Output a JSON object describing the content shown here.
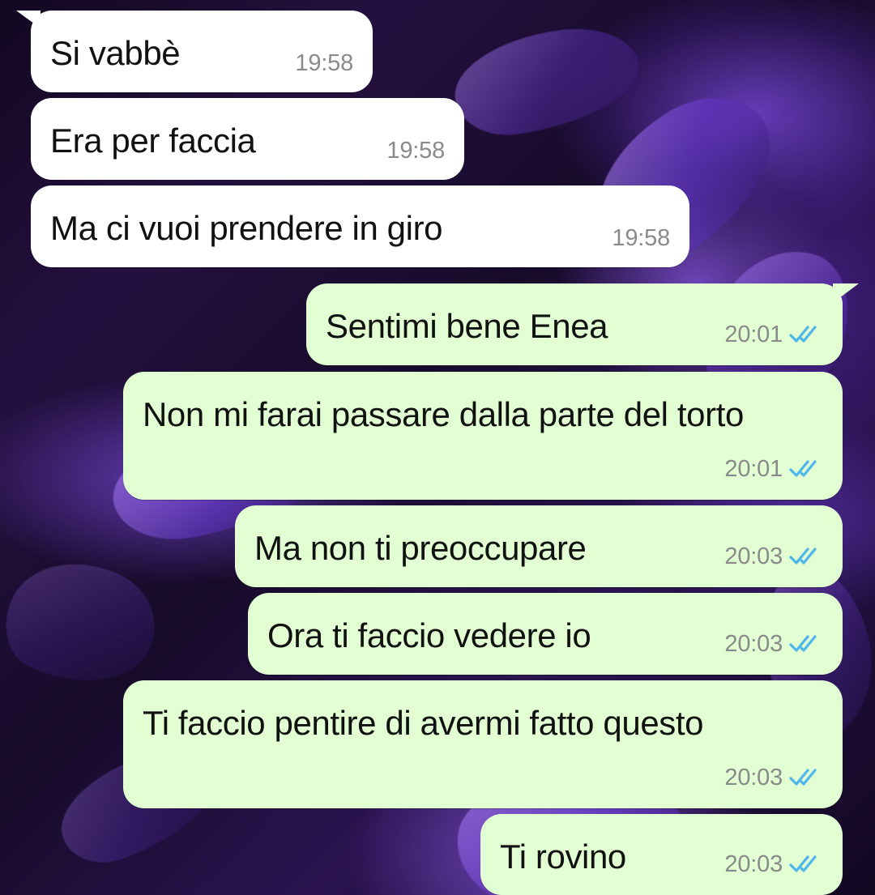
{
  "conversation": {
    "messages": [
      {
        "text": "Si vabbè",
        "time": "19:58"
      },
      {
        "text": "Era per faccia",
        "time": "19:58"
      },
      {
        "text": "Ma ci vuoi prendere in giro",
        "time": "19:58"
      },
      {
        "text": "Sentimi bene Enea",
        "time": "20:01"
      },
      {
        "text": "Non mi farai passare dalla parte del torto",
        "time": "20:01"
      },
      {
        "text": "Ma non ti preoccupare",
        "time": "20:03"
      },
      {
        "text": "Ora ti faccio vedere io",
        "time": "20:03"
      },
      {
        "text": "Ti faccio pentire di avermi fatto questo",
        "time": "20:03"
      },
      {
        "text": "Ti rovino",
        "time": "20:03"
      }
    ]
  },
  "icons": {
    "read_receipt": "double-check-icon",
    "read_receipt_color": "#4fb6ec"
  },
  "colors": {
    "incoming_bubble": "#ffffff",
    "outgoing_bubble": "#e1ffd2",
    "timestamp_text": "#8a8a8a"
  }
}
